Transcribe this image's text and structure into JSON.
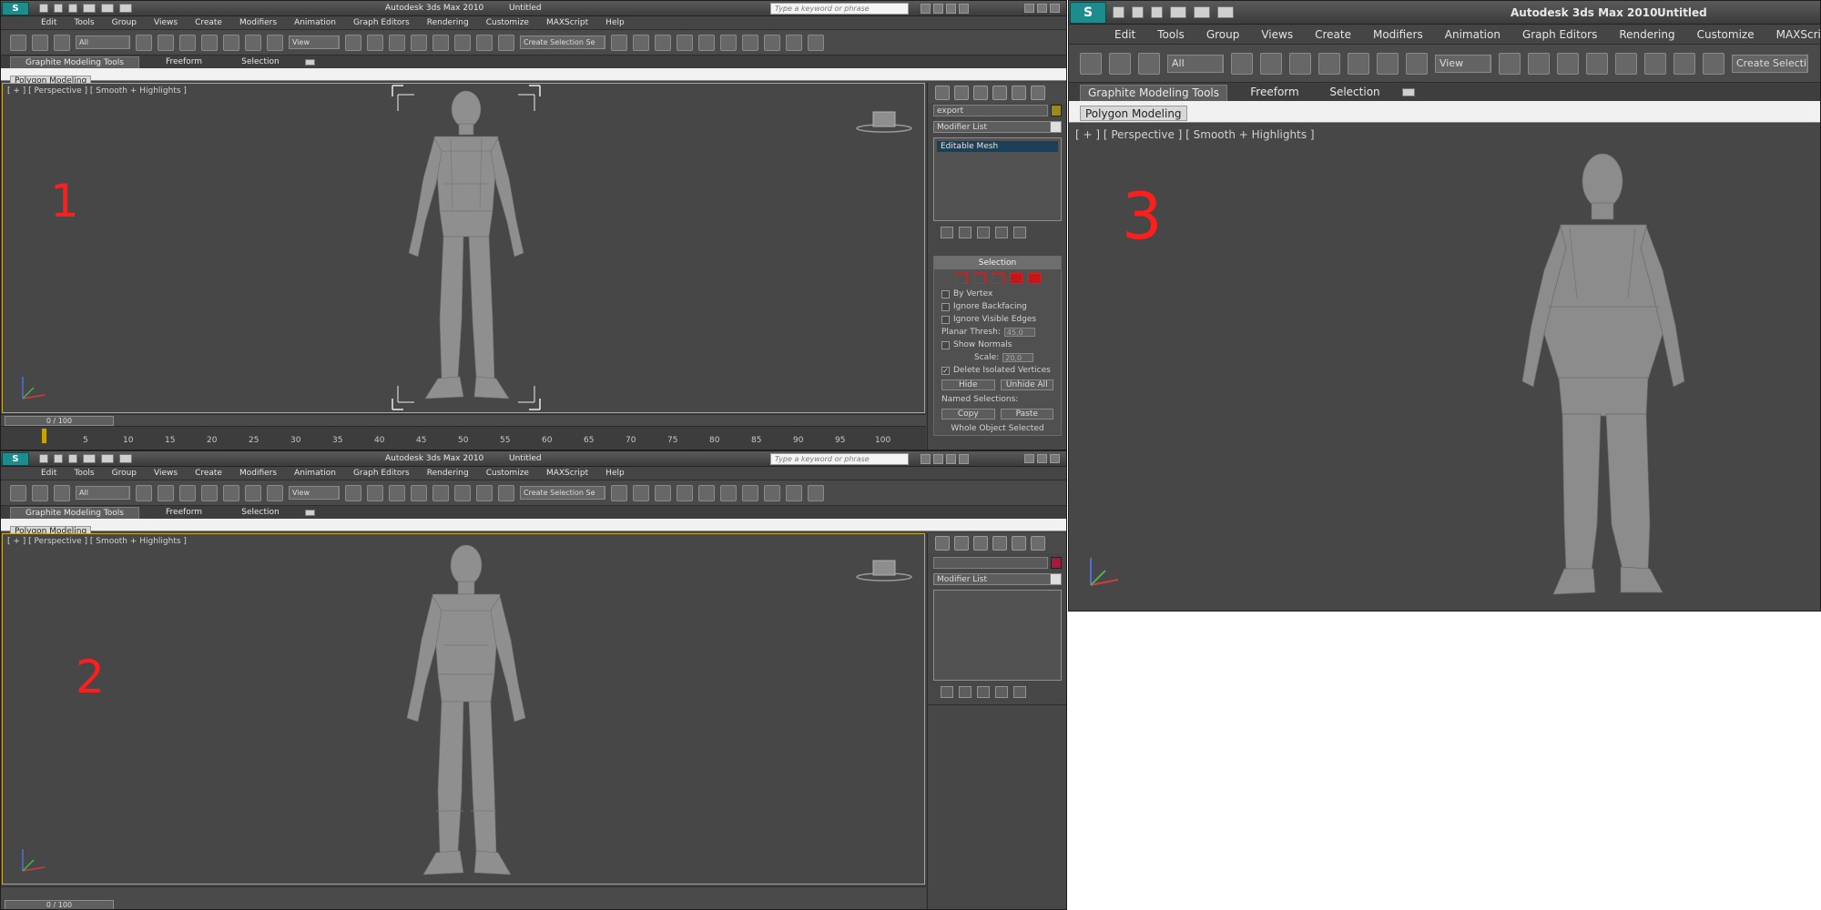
{
  "app": {
    "title": "Autodesk 3ds Max  2010",
    "doc": "Untitled",
    "search_placeholder": "Type a keyword or phrase"
  },
  "menu": [
    "Edit",
    "Tools",
    "Group",
    "Views",
    "Create",
    "Modifiers",
    "Animation",
    "Graph Editors",
    "Rendering",
    "Customize",
    "MAXScript",
    "Help"
  ],
  "toolbar": {
    "selection_filter": "All",
    "ref_coord": "View",
    "named_selection": "Create Selection Se",
    "named_selection_full": "Create Selectio"
  },
  "ribbon": {
    "tabs": [
      "Graphite Modeling Tools",
      "Freeform",
      "Selection"
    ],
    "panel_label": "Polygon Modeling"
  },
  "viewport": {
    "label": "[ + ] [ Perspective ] [ Smooth + Highlights ]"
  },
  "panes": {
    "one": "1",
    "two": "2",
    "three": "3"
  },
  "command_panel": {
    "object_name": "export",
    "modifier_list": "Modifier List",
    "stack_item": "Editable Mesh"
  },
  "selection_rollout": {
    "title": "Selection",
    "by_vertex": "By Vertex",
    "ignore_backfacing": "Ignore Backfacing",
    "ignore_visible_edges": "Ignore Visible Edges",
    "planar_thresh_label": "Planar Thresh:",
    "planar_thresh": "45,0",
    "show_normals": "Show Normals",
    "scale_label": "Scale:",
    "scale": "20,0",
    "delete_isolated": "Delete Isolated Vertices",
    "delete_isolated_checked": "✓",
    "hide": "Hide",
    "unhide_all": "Unhide All",
    "named_selections": "Named Selections:",
    "copy": "Copy",
    "paste": "Paste",
    "status": "Whole Object Selected"
  },
  "time_slider": {
    "frame": "0 / 100",
    "ticks": [
      "5",
      "10",
      "15",
      "20",
      "25",
      "30",
      "35",
      "40",
      "45",
      "50",
      "55",
      "60",
      "65",
      "70",
      "75",
      "80",
      "85",
      "90",
      "95",
      "100"
    ]
  },
  "colors": {
    "object_color_1": "#9c8a1c",
    "object_color_2": "#a8183c",
    "annotation_red": "#ff1d1d"
  },
  "icons": [
    "app-logo-icon",
    "new-icon",
    "open-icon",
    "save-icon",
    "undo-icon",
    "redo-icon",
    "viewcube-icon",
    "axis-tripod-icon",
    "create-tab-icon",
    "modify-tab-icon",
    "hierarchy-tab-icon",
    "motion-tab-icon",
    "display-tab-icon",
    "utilities-tab-icon"
  ]
}
